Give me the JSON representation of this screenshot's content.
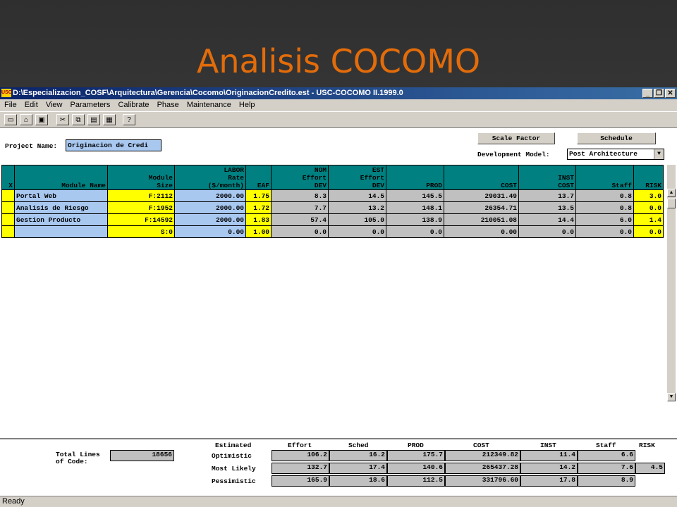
{
  "slide": {
    "title": "Analisis COCOMO"
  },
  "window": {
    "icon_text": "USC",
    "title": "D:\\Especializacion_COSF\\Arquitectura\\Gerencia\\Cocomo\\OriginacionCredito.est - USC-COCOMO II.1999.0"
  },
  "menu": [
    "File",
    "Edit",
    "View",
    "Parameters",
    "Calibrate",
    "Phase",
    "Maintenance",
    "Help"
  ],
  "toolbar_icons": [
    "new-file-icon",
    "open-folder-icon",
    "save-icon",
    "cut-icon",
    "copy-icon",
    "paste-icon",
    "calculator-icon",
    "help-icon"
  ],
  "buttons": {
    "scale_factor": "Scale Factor",
    "schedule": "Schedule"
  },
  "project": {
    "label": "Project Name:",
    "value": "Originacion de Credi"
  },
  "dev_model": {
    "label": "Development Model:",
    "value": "Post Architecture",
    "arrow": "▼"
  },
  "columns": {
    "x": "X",
    "module_name": "Module Name",
    "module_size": [
      "Module",
      "Size"
    ],
    "labor_rate": [
      "LABOR",
      "Rate",
      "($/month)"
    ],
    "eaf": "EAF",
    "nom_effort": [
      "NOM",
      "Effort",
      "DEV"
    ],
    "est_effort": [
      "EST",
      "Effort",
      "DEV"
    ],
    "prod": "PROD",
    "cost": "COST",
    "inst_cost": [
      "INST",
      "COST"
    ],
    "staff": "Staff",
    "risk": "RISK"
  },
  "rows": [
    {
      "x": "",
      "name": "Portal Web",
      "size": "F:2112",
      "rate": "2000.00",
      "eaf": "1.75",
      "nom": "8.3",
      "est": "14.5",
      "prod": "145.5",
      "cost": "29031.49",
      "inst": "13.7",
      "staff": "0.8",
      "risk": "3.0"
    },
    {
      "x": "",
      "name": "Analisis de Riesgo",
      "size": "F:1952",
      "rate": "2000.00",
      "eaf": "1.72",
      "nom": "7.7",
      "est": "13.2",
      "prod": "148.1",
      "cost": "26354.71",
      "inst": "13.5",
      "staff": "0.8",
      "risk": "0.0"
    },
    {
      "x": "",
      "name": "Gestion Producto",
      "size": "F:14592",
      "rate": "2000.00",
      "eaf": "1.83",
      "nom": "57.4",
      "est": "105.0",
      "prod": "138.9",
      "cost": "210051.08",
      "inst": "14.4",
      "staff": "6.0",
      "risk": "1.4"
    },
    {
      "x": "",
      "name": "",
      "size": "S:0",
      "rate": "0.00",
      "eaf": "1.00",
      "nom": "0.0",
      "est": "0.0",
      "prod": "0.0",
      "cost": "0.00",
      "inst": "0.0",
      "staff": "0.0",
      "risk": "0.0"
    }
  ],
  "totals": {
    "loc_label_1": "Total Lines",
    "loc_label_2": "of Code:",
    "loc_value": "18656",
    "headers": {
      "estimated": "Estimated",
      "effort": "Effort",
      "sched": "Sched",
      "prod": "PROD",
      "cost": "COST",
      "inst": "INST",
      "staff": "Staff",
      "risk": "RISK"
    },
    "optimistic": {
      "label": "Optimistic",
      "effort": "106.2",
      "sched": "16.2",
      "prod": "175.7",
      "cost": "212349.82",
      "inst": "11.4",
      "staff": "6.6",
      "risk": ""
    },
    "most_likely": {
      "label": "Most Likely",
      "effort": "132.7",
      "sched": "17.4",
      "prod": "140.6",
      "cost": "265437.28",
      "inst": "14.2",
      "staff": "7.6",
      "risk": "4.5"
    },
    "pessimistic": {
      "label": "Pessimistic",
      "effort": "165.9",
      "sched": "18.6",
      "prod": "112.5",
      "cost": "331796.60",
      "inst": "17.8",
      "staff": "8.9",
      "risk": ""
    }
  },
  "status": "Ready"
}
